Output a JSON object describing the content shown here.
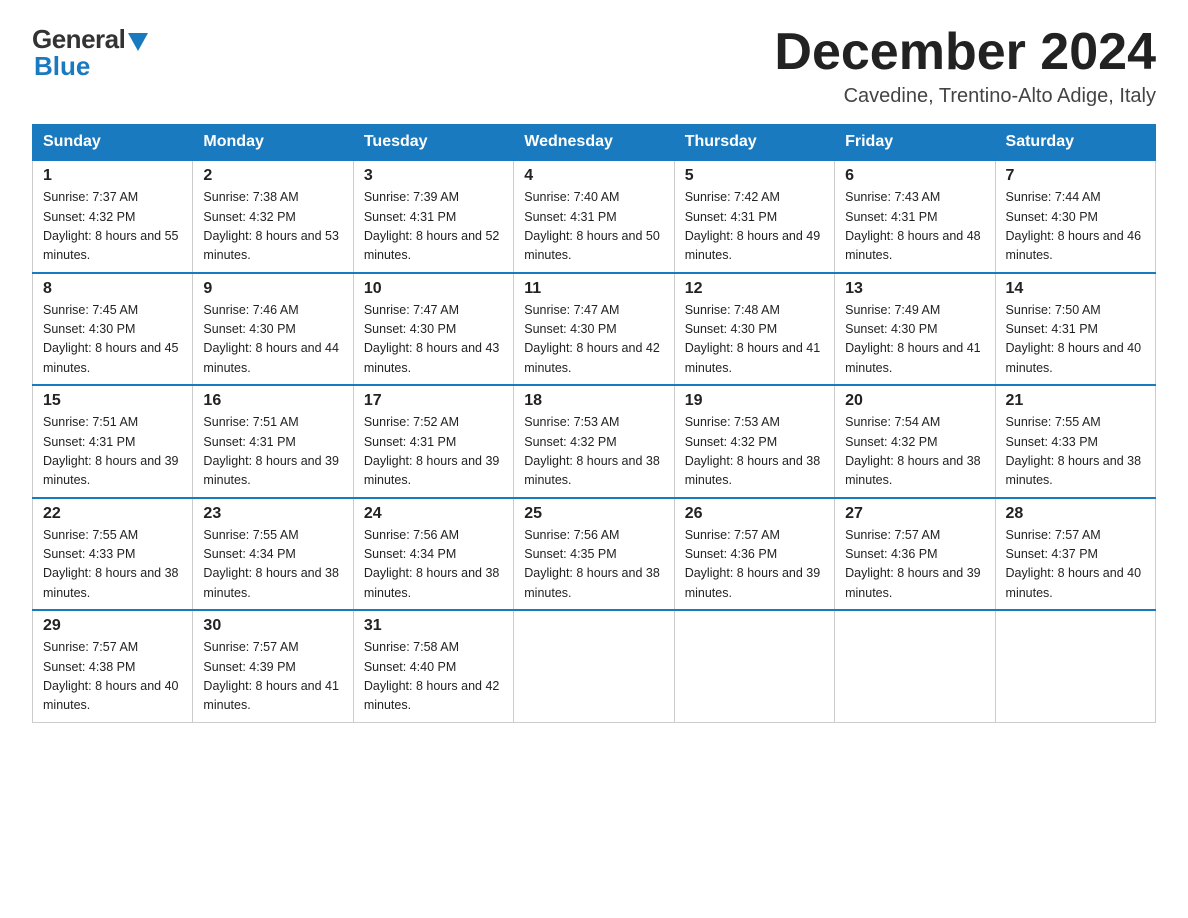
{
  "logo": {
    "general": "General",
    "blue": "Blue"
  },
  "header": {
    "title": "December 2024",
    "subtitle": "Cavedine, Trentino-Alto Adige, Italy"
  },
  "days": [
    "Sunday",
    "Monday",
    "Tuesday",
    "Wednesday",
    "Thursday",
    "Friday",
    "Saturday"
  ],
  "weeks": [
    [
      {
        "num": "1",
        "sunrise": "7:37 AM",
        "sunset": "4:32 PM",
        "daylight": "8 hours and 55 minutes."
      },
      {
        "num": "2",
        "sunrise": "7:38 AM",
        "sunset": "4:32 PM",
        "daylight": "8 hours and 53 minutes."
      },
      {
        "num": "3",
        "sunrise": "7:39 AM",
        "sunset": "4:31 PM",
        "daylight": "8 hours and 52 minutes."
      },
      {
        "num": "4",
        "sunrise": "7:40 AM",
        "sunset": "4:31 PM",
        "daylight": "8 hours and 50 minutes."
      },
      {
        "num": "5",
        "sunrise": "7:42 AM",
        "sunset": "4:31 PM",
        "daylight": "8 hours and 49 minutes."
      },
      {
        "num": "6",
        "sunrise": "7:43 AM",
        "sunset": "4:31 PM",
        "daylight": "8 hours and 48 minutes."
      },
      {
        "num": "7",
        "sunrise": "7:44 AM",
        "sunset": "4:30 PM",
        "daylight": "8 hours and 46 minutes."
      }
    ],
    [
      {
        "num": "8",
        "sunrise": "7:45 AM",
        "sunset": "4:30 PM",
        "daylight": "8 hours and 45 minutes."
      },
      {
        "num": "9",
        "sunrise": "7:46 AM",
        "sunset": "4:30 PM",
        "daylight": "8 hours and 44 minutes."
      },
      {
        "num": "10",
        "sunrise": "7:47 AM",
        "sunset": "4:30 PM",
        "daylight": "8 hours and 43 minutes."
      },
      {
        "num": "11",
        "sunrise": "7:47 AM",
        "sunset": "4:30 PM",
        "daylight": "8 hours and 42 minutes."
      },
      {
        "num": "12",
        "sunrise": "7:48 AM",
        "sunset": "4:30 PM",
        "daylight": "8 hours and 41 minutes."
      },
      {
        "num": "13",
        "sunrise": "7:49 AM",
        "sunset": "4:30 PM",
        "daylight": "8 hours and 41 minutes."
      },
      {
        "num": "14",
        "sunrise": "7:50 AM",
        "sunset": "4:31 PM",
        "daylight": "8 hours and 40 minutes."
      }
    ],
    [
      {
        "num": "15",
        "sunrise": "7:51 AM",
        "sunset": "4:31 PM",
        "daylight": "8 hours and 39 minutes."
      },
      {
        "num": "16",
        "sunrise": "7:51 AM",
        "sunset": "4:31 PM",
        "daylight": "8 hours and 39 minutes."
      },
      {
        "num": "17",
        "sunrise": "7:52 AM",
        "sunset": "4:31 PM",
        "daylight": "8 hours and 39 minutes."
      },
      {
        "num": "18",
        "sunrise": "7:53 AM",
        "sunset": "4:32 PM",
        "daylight": "8 hours and 38 minutes."
      },
      {
        "num": "19",
        "sunrise": "7:53 AM",
        "sunset": "4:32 PM",
        "daylight": "8 hours and 38 minutes."
      },
      {
        "num": "20",
        "sunrise": "7:54 AM",
        "sunset": "4:32 PM",
        "daylight": "8 hours and 38 minutes."
      },
      {
        "num": "21",
        "sunrise": "7:55 AM",
        "sunset": "4:33 PM",
        "daylight": "8 hours and 38 minutes."
      }
    ],
    [
      {
        "num": "22",
        "sunrise": "7:55 AM",
        "sunset": "4:33 PM",
        "daylight": "8 hours and 38 minutes."
      },
      {
        "num": "23",
        "sunrise": "7:55 AM",
        "sunset": "4:34 PM",
        "daylight": "8 hours and 38 minutes."
      },
      {
        "num": "24",
        "sunrise": "7:56 AM",
        "sunset": "4:34 PM",
        "daylight": "8 hours and 38 minutes."
      },
      {
        "num": "25",
        "sunrise": "7:56 AM",
        "sunset": "4:35 PM",
        "daylight": "8 hours and 38 minutes."
      },
      {
        "num": "26",
        "sunrise": "7:57 AM",
        "sunset": "4:36 PM",
        "daylight": "8 hours and 39 minutes."
      },
      {
        "num": "27",
        "sunrise": "7:57 AM",
        "sunset": "4:36 PM",
        "daylight": "8 hours and 39 minutes."
      },
      {
        "num": "28",
        "sunrise": "7:57 AM",
        "sunset": "4:37 PM",
        "daylight": "8 hours and 40 minutes."
      }
    ],
    [
      {
        "num": "29",
        "sunrise": "7:57 AM",
        "sunset": "4:38 PM",
        "daylight": "8 hours and 40 minutes."
      },
      {
        "num": "30",
        "sunrise": "7:57 AM",
        "sunset": "4:39 PM",
        "daylight": "8 hours and 41 minutes."
      },
      {
        "num": "31",
        "sunrise": "7:58 AM",
        "sunset": "4:40 PM",
        "daylight": "8 hours and 42 minutes."
      },
      null,
      null,
      null,
      null
    ]
  ]
}
